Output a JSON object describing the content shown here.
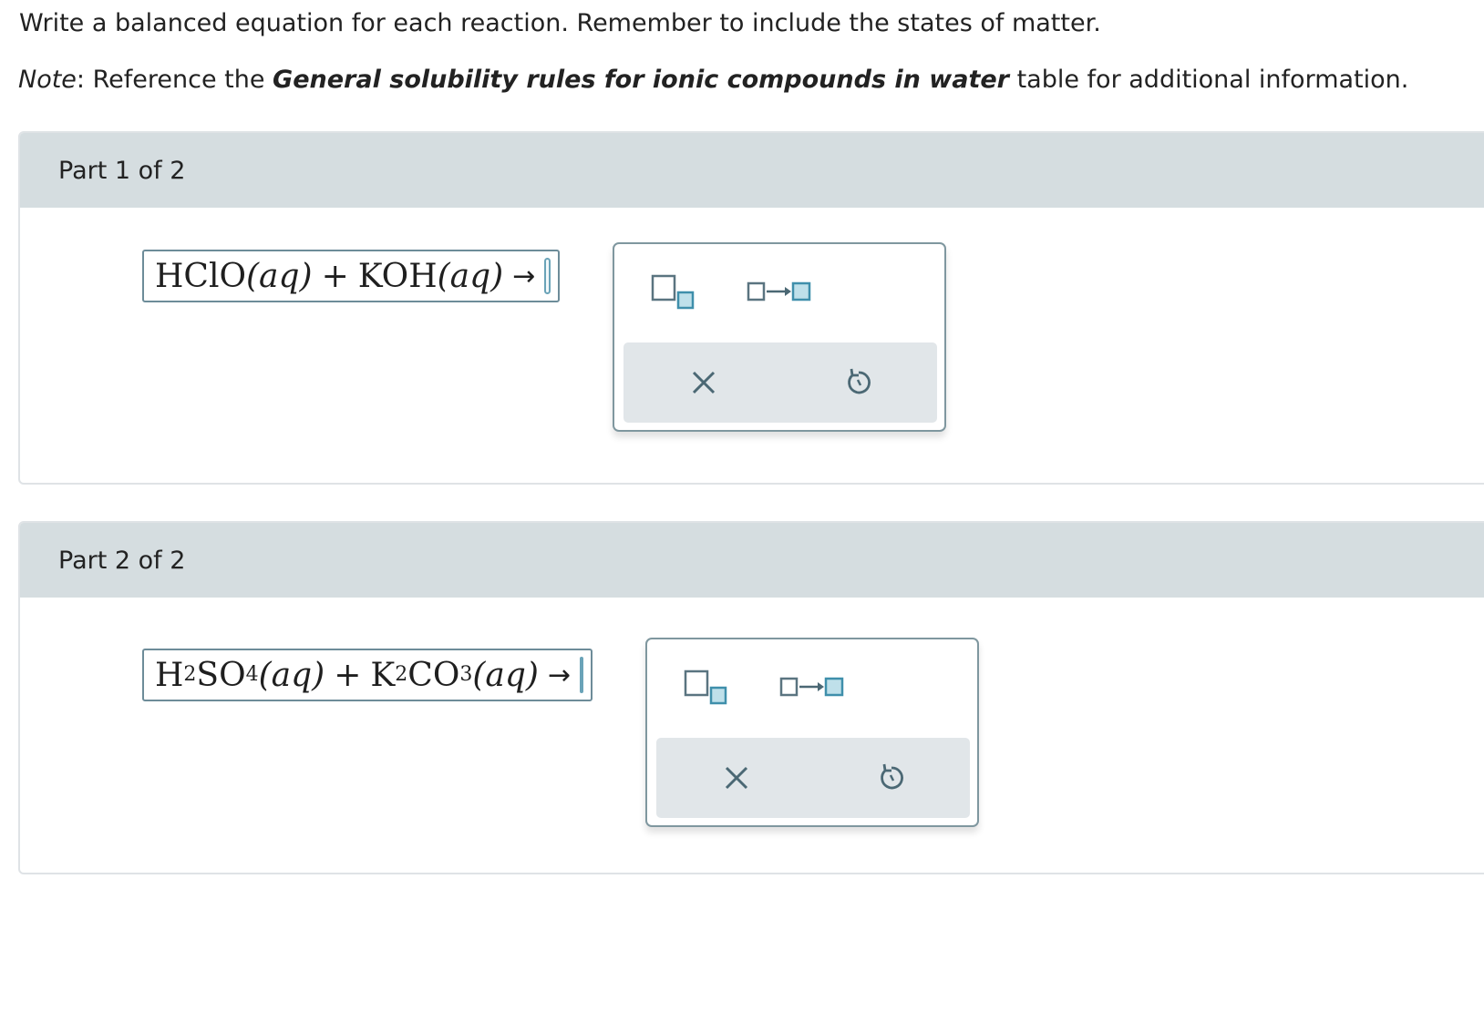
{
  "instructions": "Write a balanced equation for each reaction. Remember to include the states of matter.",
  "note": {
    "label": "Note",
    "sep": ": Reference the ",
    "table_name": "General solubility rules for ionic compounds in water",
    "suffix": " table for additional information."
  },
  "parts": [
    {
      "header": "Part 1 of 2",
      "reactants": {
        "r1": "HClO",
        "r1_state": "(aq)",
        "plus": "+",
        "r2": "KOH",
        "r2_state": "(aq)",
        "arrow": "→"
      }
    },
    {
      "header": "Part 2 of 2",
      "reactants": {
        "r1a": "H",
        "r1a_sub": "2",
        "r1b": "SO",
        "r1b_sub": "4",
        "r1_state": "(aq)",
        "plus": "+",
        "r2a": "K",
        "r2a_sub": "2",
        "r2b": "CO",
        "r2b_sub": "3",
        "r2_state": "(aq)",
        "arrow": "→"
      }
    }
  ],
  "toolbox_icons": {
    "subscript_tool": "subscript-box-icon",
    "reaction_arrow_tool": "reaction-arrow-icon",
    "clear": "x-icon",
    "undo": "undo-icon"
  },
  "colors": {
    "header_bg": "#d5dde0",
    "accent_teal": "#3f8fab",
    "accent_fill": "#bfe0ea",
    "icon_gray": "#4b6874"
  }
}
